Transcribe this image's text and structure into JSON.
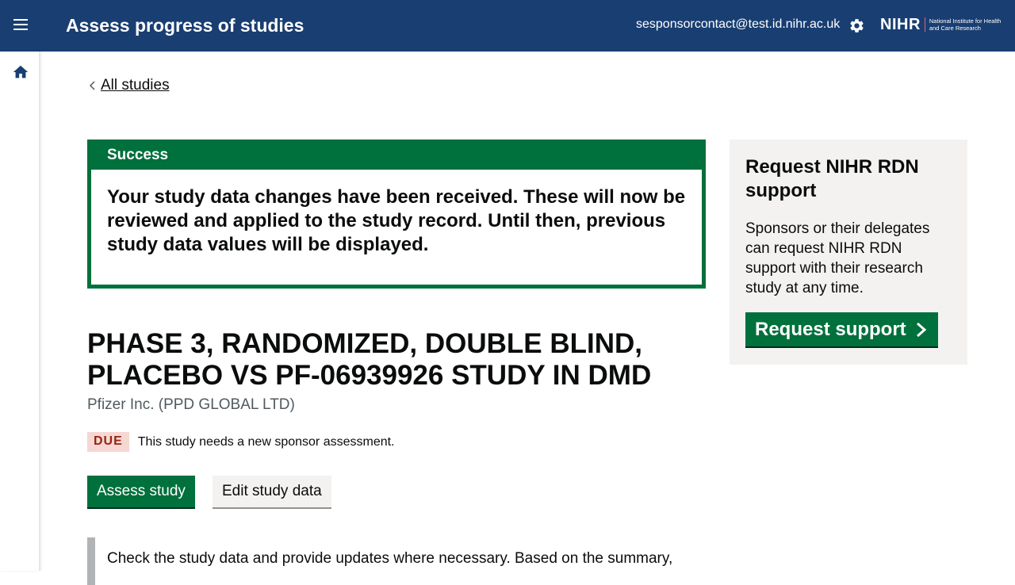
{
  "header": {
    "app_title": "Assess progress of studies",
    "user_email": "sesponsorcontact@test.id.nihr.ac.uk",
    "logo_main": "NIHR",
    "logo_sub": "National Institute for Health and Care Research"
  },
  "nav": {
    "back_label": "All studies"
  },
  "success_banner": {
    "heading": "Success",
    "message": "Your study data changes have been received. These will now be reviewed and applied to the study record. Until then, previous study data values will be displayed."
  },
  "study": {
    "title": "PHASE 3, RANDOMIZED, DOUBLE BLIND, PLACEBO VS PF-06939926 STUDY IN DMD",
    "sponsor": "Pfizer Inc. (PPD GLOBAL LTD)",
    "status_tag": "DUE",
    "status_text": "This study needs a new sponsor assessment.",
    "assess_button": "Assess study",
    "edit_button": "Edit study data",
    "inset_text": "Check the study data and provide updates where necessary. Based on the summary,"
  },
  "support_panel": {
    "title": "Request NIHR RDN support",
    "text": "Sponsors or their delegates can request NIHR RDN support with their research study at any time.",
    "button_label": "Request support"
  },
  "colors": {
    "header_bg": "#193e72",
    "success_green": "#00703c",
    "due_tag_bg": "#f6d7d2",
    "due_tag_text": "#942514"
  }
}
